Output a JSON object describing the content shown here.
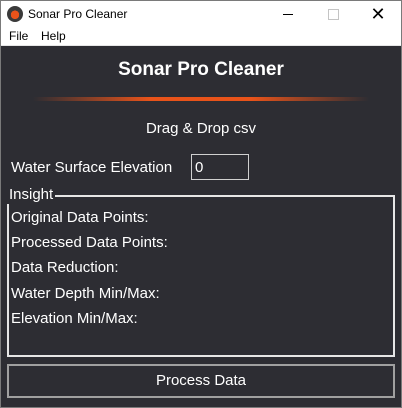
{
  "window": {
    "title": "Sonar Pro Cleaner",
    "controls": {
      "minimize": "minimize",
      "maximize": "maximize",
      "close": "✕"
    }
  },
  "menu": {
    "file": "File",
    "help": "Help"
  },
  "main": {
    "heading": "Sonar Pro Cleaner",
    "accent_color": "#e8531a",
    "drop_label": "Drag & Drop csv",
    "wse_label": "Water Surface Elevation",
    "wse_value": "0"
  },
  "insight": {
    "legend": "Insight",
    "rows": [
      "Original Data Points:",
      "Processed Data Points:",
      "Data Reduction:",
      "Water Depth Min/Max:",
      "Elevation Min/Max:"
    ]
  },
  "actions": {
    "process_label": "Process Data"
  },
  "colors": {
    "background": "#2d2d33",
    "text": "#ffffff"
  }
}
